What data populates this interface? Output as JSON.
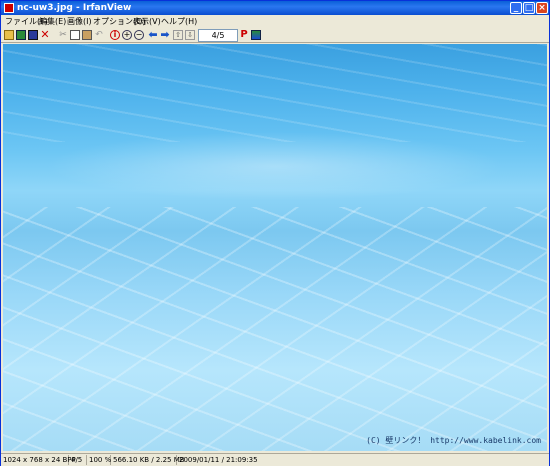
{
  "window": {
    "title": "nc-uw3.jpg - IrfanView",
    "controls": {
      "minimize": "_",
      "maximize": "□",
      "close": "×"
    }
  },
  "menu": {
    "items": [
      "ファイル(F)",
      "編集(E)",
      "画像(I)",
      "オプション(O)",
      "表示(V)",
      "ヘルプ(H)"
    ]
  },
  "toolbar": {
    "page_indicator": "4/5",
    "icons": [
      "open-folder-icon",
      "thumbnails-icon",
      "save-icon",
      "delete-icon",
      "cut-icon",
      "copy-icon",
      "paste-icon",
      "undo-icon",
      "info-icon",
      "zoom-in-icon",
      "zoom-out-icon",
      "prev-arrow-icon",
      "next-arrow-icon",
      "first-file-icon",
      "last-file-icon",
      "paint-icon",
      "scan-icon"
    ],
    "glyphs": {
      "delete": "✕",
      "cut": "✂",
      "undo": "↶",
      "info": "i",
      "zin": "+",
      "zout": "−",
      "prev": "⬅",
      "next": "➡",
      "up": "⇧",
      "down": "⇩",
      "paint": "P"
    }
  },
  "image": {
    "watermark": "(C) 壁リンク！  http://www.kabelink.com"
  },
  "status": {
    "dimensions": "1024 x 768 x 24 BPP",
    "index": "4/5",
    "zoom": "100 %",
    "size": "566.10 KB / 2.25 MB",
    "datetime": "2009/01/11 / 21:09:35"
  }
}
